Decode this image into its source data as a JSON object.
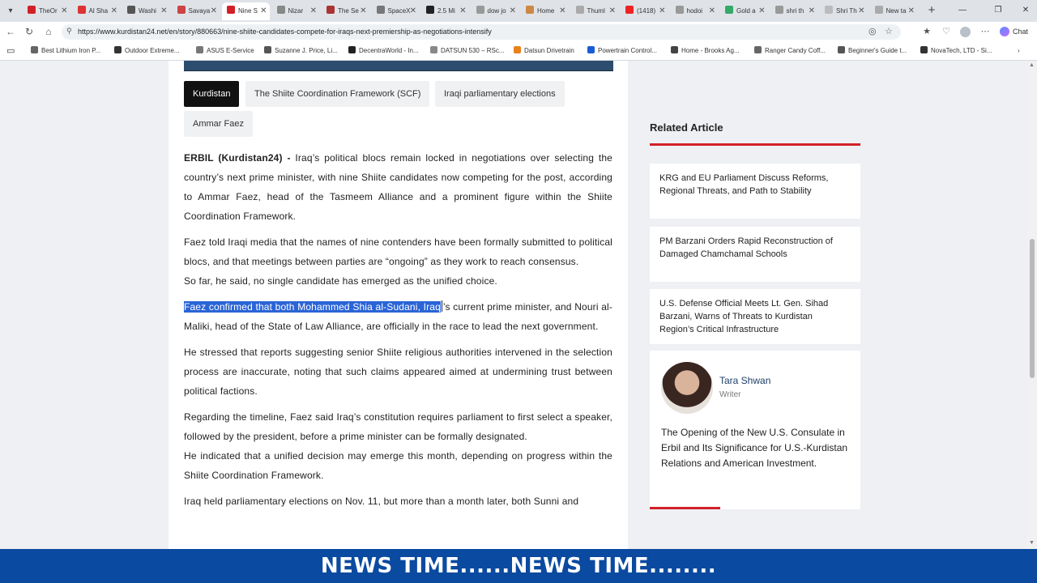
{
  "browser": {
    "tabs": [
      {
        "label": "TheOr",
        "color": "#d32027",
        "active": false
      },
      {
        "label": "Al Sha",
        "color": "#d33",
        "active": false
      },
      {
        "label": "Washi",
        "color": "#555",
        "active": false
      },
      {
        "label": "Savaya",
        "color": "#c44",
        "active": false
      },
      {
        "label": "Nine S",
        "color": "#d32027",
        "active": true
      },
      {
        "label": "Nizar",
        "color": "#888",
        "active": false
      },
      {
        "label": "The Se",
        "color": "#a33",
        "active": false
      },
      {
        "label": "SpaceX",
        "color": "#777",
        "active": false
      },
      {
        "label": "2.5 Mi",
        "color": "#222",
        "active": false
      },
      {
        "label": "dow jo",
        "color": "#999",
        "active": false
      },
      {
        "label": "Home",
        "color": "#c84",
        "active": false
      },
      {
        "label": "Thuml",
        "color": "#aaa",
        "active": false
      },
      {
        "label": "(1418)",
        "color": "#e22",
        "active": false
      },
      {
        "label": "hodoi",
        "color": "#999",
        "active": false
      },
      {
        "label": "Gold a",
        "color": "#3a6",
        "active": false
      },
      {
        "label": "shri th",
        "color": "#999",
        "active": false
      },
      {
        "label": "Shri Th",
        "color": "#bbb",
        "active": false
      },
      {
        "label": "New ta",
        "color": "#aaa",
        "active": false
      }
    ],
    "url": "https://www.kurdistan24.net/en/story/880663/nine-shiite-candidates-compete-for-iraqs-next-premiership-as-negotiations-intensify",
    "chat_label": "Chat",
    "bookmarks": [
      "Best Lithium Iron P...",
      "Outdoor Extreme...",
      "ASUS E-Service",
      "Suzanne J. Price, Li...",
      "DecentraWorld - In...",
      "DATSUN 530 – RSc...",
      "Datsun Drivetrain",
      "Powertrain Control...",
      "Home - Brooks Ag...",
      "Ranger Candy Coff...",
      "Beginner's Guide t...",
      "NovaTech, LTD - Si..."
    ]
  },
  "article": {
    "tags": [
      "Kurdistan",
      "The Shiite Coordination Framework (SCF)",
      "Iraqi parliamentary elections",
      "Ammar Faez"
    ],
    "p1_lead": "ERBIL (Kurdistan24) -",
    "p1_text": " Iraq’s political blocs remain locked in negotiations over selecting the country’s next prime minister, with nine Shiite candidates now competing for the post, according to Ammar Faez, head of the Tasmeem Alliance and a prominent figure within the Shiite Coordination Framework.",
    "p2": "Faez told Iraqi media that the names of nine contenders have been formally submitted to political blocs, and that meetings between parties are “ongoing” as they work to reach consensus.",
    "p3": "So far, he said, no single candidate has emerged as the unified choice.",
    "p4_selected": "Faez confirmed that both Mohammed Shia al-Sudani, Iraq",
    "p4_rest": "’s current prime minister, and Nouri al-Maliki, head of the State of Law Alliance, are officially in the race to lead the next government.",
    "p5": "He stressed that reports suggesting senior Shiite religious authorities intervened in the selection process are inaccurate, noting that such claims appeared aimed at undermining trust between political factions.",
    "p6": "Regarding the timeline, Faez said Iraq’s constitution requires parliament to first select a speaker, followed by the president, before a prime minister can be formally designated.",
    "p7": "He indicated that a unified decision may emerge this month, depending on progress within the Shiite Coordination Framework.",
    "p8": "Iraq held parliamentary elections on Nov. 11, but more than a month later, both Sunni and"
  },
  "sidebar": {
    "title": "Related Article",
    "related": [
      "KRG and EU Parliament Discuss Reforms, Regional Threats, and Path to Stability",
      "PM Barzani Orders Rapid Reconstruction of Damaged Chamchamal Schools",
      "U.S. Defense Official Meets Lt. Gen. Sihad Barzani, Warns of Threats to Kurdistan Region’s Critical Infrastructure"
    ],
    "author": {
      "name": "Tara Shwan",
      "role": "Writer",
      "article": "The Opening of the New U.S. Consulate in Erbil and Its Significance for U.S.-Kurdistan Relations and American Investment."
    }
  },
  "banner": "NEWS TIME......NEWS TIME........",
  "colors": {
    "accent": "#d32027",
    "banner": "#0a4aa0",
    "selection": "#2a64d6",
    "tag_active": "#111111"
  }
}
